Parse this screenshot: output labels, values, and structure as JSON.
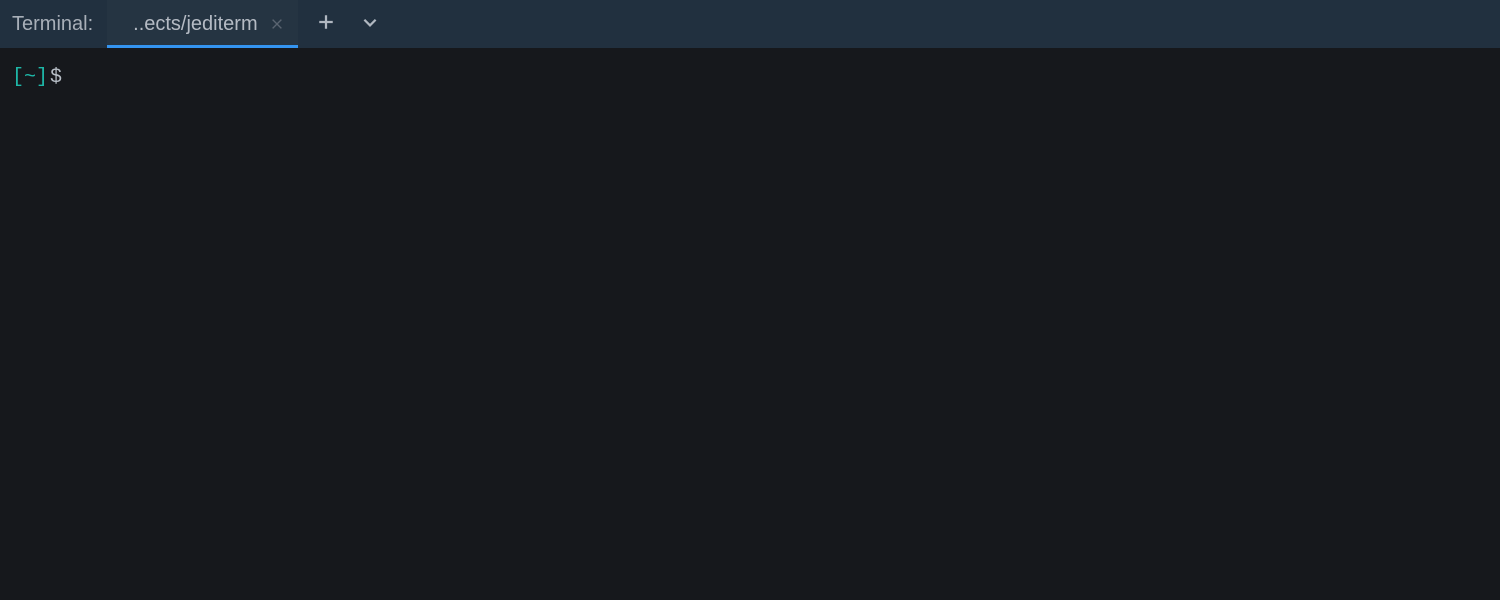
{
  "header": {
    "panel_title": "Terminal:",
    "tabs": [
      {
        "label": "..ects/jediterm"
      }
    ]
  },
  "prompt": {
    "open_bracket": "[",
    "path": "~",
    "close_bracket": "]",
    "symbol": "$"
  }
}
